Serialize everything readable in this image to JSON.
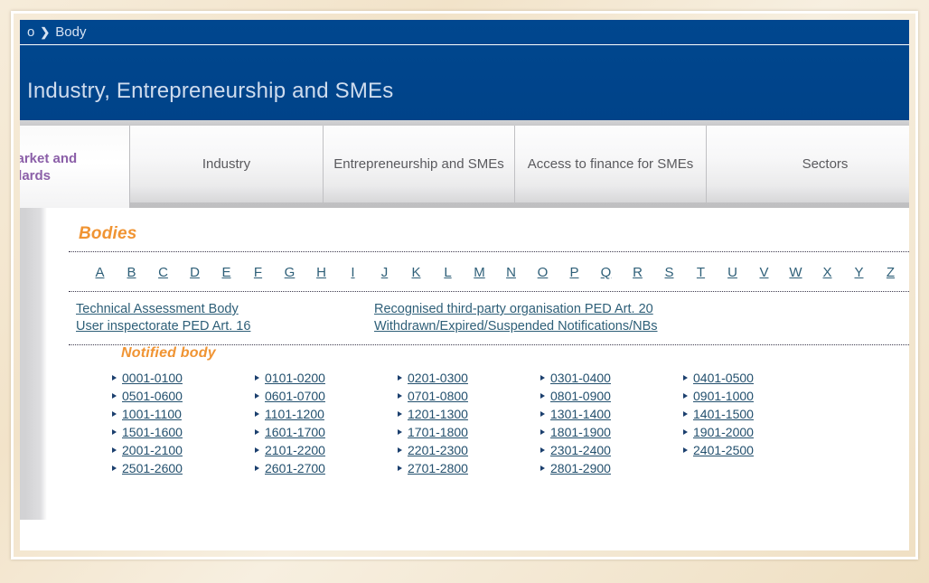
{
  "header": {
    "breadcrumb_prefix": "o",
    "breadcrumb_sep": "❯",
    "breadcrumb_current": "Body",
    "site_title": "Industry, Entrepreneurship and SMEs",
    "header_color": "#00468c",
    "title_color": "#cfdcee"
  },
  "tabs": [
    {
      "label_line1": "Market and",
      "label_line2": "ndards",
      "active": true
    },
    {
      "label_line1": "Industry",
      "label_line2": "",
      "active": false
    },
    {
      "label_line1": "Entrepreneurship and SMEs",
      "label_line2": "",
      "active": false
    },
    {
      "label_line1": "Access to finance for SMEs",
      "label_line2": "",
      "active": false
    },
    {
      "label_line1": "Sectors",
      "label_line2": "",
      "active": false
    }
  ],
  "content": {
    "heading": "Bodies",
    "heading_color": "#f09433",
    "link_color": "#2e5f78",
    "alphabet": [
      "A",
      "B",
      "C",
      "D",
      "E",
      "F",
      "G",
      "H",
      "I",
      "J",
      "K",
      "L",
      "M",
      "N",
      "O",
      "P",
      "Q",
      "R",
      "S",
      "T",
      "U",
      "V",
      "W",
      "X",
      "Y",
      "Z"
    ],
    "named_links": {
      "column1": [
        "Technical Assessment Body",
        "User inspectorate PED Art. 16"
      ],
      "column2": [
        "Recognised third-party organisation PED Art. 20",
        "Withdrawn/Expired/Suspended Notifications/NBs"
      ]
    },
    "notified_body": {
      "heading": "Notified body",
      "columns": [
        [
          "0001-0100",
          "0501-0600",
          "1001-1100",
          "1501-1600",
          "2001-2100",
          "2501-2600"
        ],
        [
          "0101-0200",
          "0601-0700",
          "1101-1200",
          "1601-1700",
          "2101-2200",
          "2601-2700"
        ],
        [
          "0201-0300",
          "0701-0800",
          "1201-1300",
          "1701-1800",
          "2201-2300",
          "2701-2800"
        ],
        [
          "0301-0400",
          "0801-0900",
          "1301-1400",
          "1801-1900",
          "2301-2400",
          "2801-2900"
        ],
        [
          "0401-0500",
          "0901-1000",
          "1401-1500",
          "1901-2000",
          "2401-2500"
        ]
      ]
    }
  }
}
